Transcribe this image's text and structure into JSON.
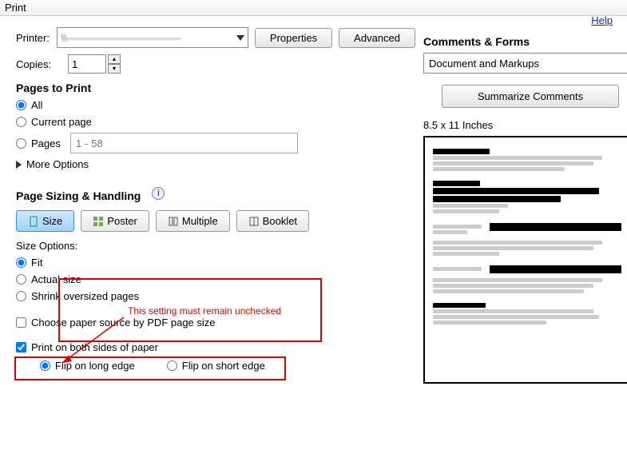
{
  "window": {
    "title": "Print"
  },
  "printer": {
    "label": "Printer:",
    "value": "\\\\———————————",
    "properties_btn": "Properties",
    "advanced_btn": "Advanced"
  },
  "help_link": "Help",
  "copies": {
    "label": "Copies:",
    "value": "1"
  },
  "pages_to_print": {
    "title": "Pages to Print",
    "all": "All",
    "current": "Current page",
    "pages": "Pages",
    "range_placeholder": "1 - 58",
    "more_options": "More Options",
    "selected": "all"
  },
  "sizing": {
    "title": "Page Sizing & Handling",
    "size_btn": "Size",
    "poster_btn": "Poster",
    "multiple_btn": "Multiple",
    "booklet_btn": "Booklet",
    "options_label": "Size Options:",
    "fit": "Fit",
    "actual": "Actual size",
    "shrink": "Shrink oversized pages",
    "selected": "fit",
    "paper_source": "Choose paper source by PDF page size",
    "paper_source_checked": false,
    "duplex": "Print on both sides of paper",
    "duplex_checked": true,
    "flip_long": "Flip on long edge",
    "flip_short": "Flip on short edge",
    "flip_selected": "long"
  },
  "comments": {
    "title": "Comments & Forms",
    "select_value": "Document and Markups",
    "summarize_btn": "Summarize Comments"
  },
  "preview": {
    "dimensions": "8.5 x 11 Inches"
  },
  "annotation": {
    "text": "This setting must remain unchecked"
  }
}
